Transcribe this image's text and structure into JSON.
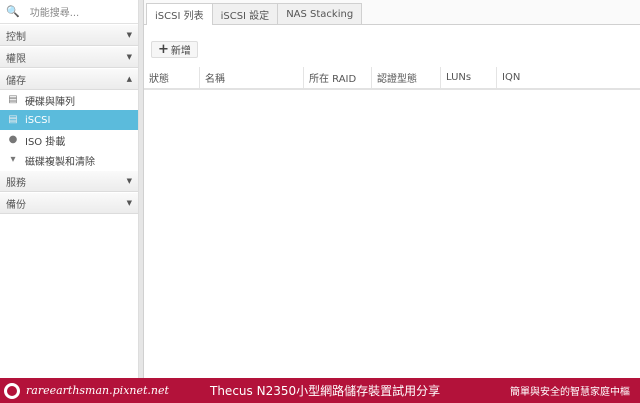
{
  "sidebar": {
    "search_placeholder": "功能搜尋...",
    "groups": {
      "control": "控制",
      "privilege": "權限",
      "storage": "儲存",
      "service": "服務",
      "backup": "備份"
    },
    "storage_items": [
      "硬碟與陣列",
      "iSCSI",
      "ISO 掛載",
      "磁碟複製和清除"
    ]
  },
  "tabs": [
    "iSCSI 列表",
    "iSCSI 設定",
    "NAS Stacking"
  ],
  "toolbar": {
    "add_label": "新增"
  },
  "table": {
    "columns": [
      "狀態",
      "名稱",
      "所在 RAID",
      "認證型態",
      "LUNs",
      "IQN"
    ]
  },
  "banner": {
    "site": "rareearthsman.pixnet.net",
    "title": "Thecus N2350小型網路儲存裝置試用分享",
    "slogan": "簡單與安全的智慧家庭中樞"
  },
  "colors": {
    "selected": "#5bbbdc",
    "banner": "#b3123a"
  }
}
